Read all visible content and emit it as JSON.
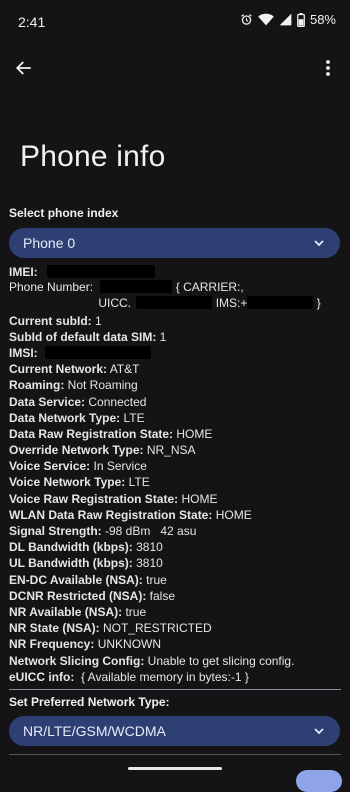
{
  "status_bar": {
    "time": "2:41",
    "battery": "58%",
    "icons": [
      "alarm-icon",
      "wifi-icon",
      "signal-icon",
      "battery-icon"
    ]
  },
  "app_bar": {
    "back_icon": "arrow-back-icon",
    "menu_icon": "more-vert-icon"
  },
  "title": "Phone info",
  "phone_index": {
    "label": "Select phone index",
    "value": "Phone 0"
  },
  "info": {
    "imei_key": "IMEI:",
    "phone_number_key": "Phone Number:",
    "phone_number_a": "{ CARRIER:,",
    "phone_number_b": "UICC.",
    "phone_number_c": "IMS:+",
    "phone_number_d": "}",
    "current_subid_key": "Current subId:",
    "current_subid_val": " 1",
    "default_data_sim_key": "SubId of default data SIM:",
    "default_data_sim_val": " 1",
    "imsi_key": "IMSI:",
    "rows": [
      {
        "k": "Current Network:",
        "v": " AT&T"
      },
      {
        "k": "Roaming:",
        "v": " Not Roaming"
      },
      {
        "k": "Data Service:",
        "v": " Connected"
      },
      {
        "k": "Data Network Type:",
        "v": " LTE"
      },
      {
        "k": "Data Raw Registration State:",
        "v": " HOME"
      },
      {
        "k": "Override Network Type:",
        "v": " NR_NSA"
      },
      {
        "k": "Voice Service:",
        "v": " In Service"
      },
      {
        "k": "Voice Network Type:",
        "v": " LTE"
      },
      {
        "k": "Voice Raw Registration State:",
        "v": " HOME"
      },
      {
        "k": "WLAN Data Raw Registration State:",
        "v": " HOME"
      },
      {
        "k": "Signal Strength:",
        "v": " -98 dBm   42 asu"
      },
      {
        "k": "DL Bandwidth (kbps):",
        "v": " 3810"
      },
      {
        "k": "UL Bandwidth (kbps):",
        "v": " 3810"
      },
      {
        "k": "EN-DC Available (NSA):",
        "v": " true"
      },
      {
        "k": "DCNR Restricted (NSA):",
        "v": " false"
      },
      {
        "k": "NR Available (NSA):",
        "v": " true"
      },
      {
        "k": "NR State (NSA):",
        "v": " NOT_RESTRICTED"
      },
      {
        "k": "NR Frequency:",
        "v": " UNKNOWN"
      },
      {
        "k": "Network Slicing Config:",
        "v": " Unable to get slicing config."
      },
      {
        "k": "eUICC info:",
        "v": "  { Available memory in bytes:-1 }"
      }
    ]
  },
  "preferred_network": {
    "label": "Set Preferred Network Type:",
    "value": "NR/LTE/GSM/WCDMA"
  }
}
